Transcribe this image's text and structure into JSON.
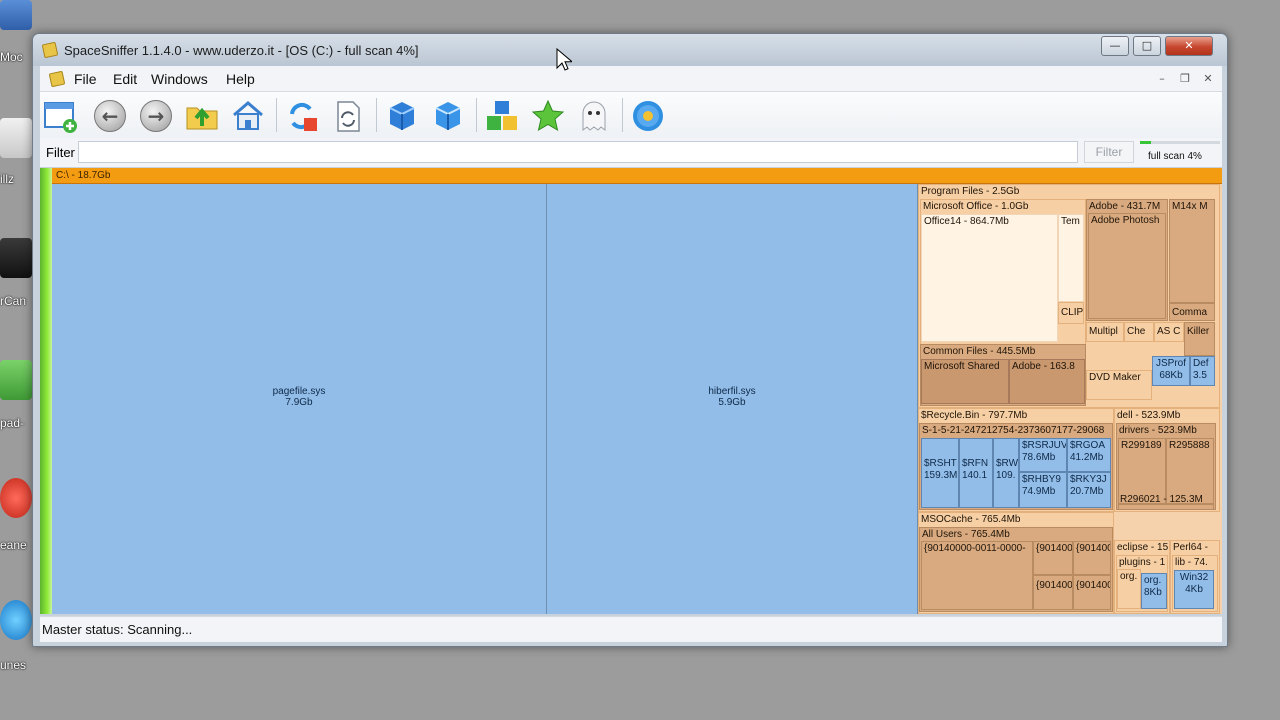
{
  "desktop": {
    "labels": [
      "Moc",
      "illz",
      "rCan",
      "pad-",
      "eane",
      "unes"
    ]
  },
  "window": {
    "title": "SpaceSniffer 1.1.4.0 - www.uderzo.it - [OS (C:) - full scan 4%]",
    "minimize": "—",
    "maximize": "□",
    "close": "✕"
  },
  "menu": {
    "file": "File",
    "edit": "Edit",
    "windows": "Windows",
    "help": "Help",
    "mdi_minimize": "–",
    "mdi_restore": "❐",
    "mdi_close": "✕"
  },
  "toolbar": {
    "icons": [
      "new-view-icon",
      "back-icon",
      "forward-icon",
      "up-folder-icon",
      "home-icon",
      "refresh-icon",
      "rescan-icon",
      "cube-icon",
      "cube-alt-icon",
      "blocks-icon",
      "star-icon",
      "ghost-icon",
      "settings-flower-icon"
    ]
  },
  "filter": {
    "label": "Filter",
    "value": "",
    "button": "Filter",
    "scan_progress": 0.04,
    "scan_text": "full scan 4%"
  },
  "treemap": {
    "root": "C:\\ - 18.7Gb",
    "pagefile_name": "pagefile.sys",
    "pagefile_size": "7.9Gb",
    "hiberfil_name": "hiberfil.sys",
    "hiberfil_size": "5.9Gb",
    "program_files": "Program Files - 2.5Gb",
    "microsoft_office": "Microsoft Office - 1.0Gb",
    "office14": "Office14 - 864.7Mb",
    "tem": "Tem",
    "clip": "CLIP",
    "adobe_pf": "Adobe - 431.7M",
    "adobe_photoshop": "Adobe Photosh",
    "m14x": "M14x M",
    "comma": "Comma",
    "multiple": "Multipl",
    "che": "Che",
    "as_c": "AS C",
    "killer": "Killer",
    "common_files": "Common Files - 445.5Mb",
    "microsoft_shared": "Microsoft Shared",
    "adobe_common": "Adobe - 163.8",
    "dvd_maker": "DVD Maker",
    "jsprof_name": "JSProf",
    "jsprof_size": "68Kb",
    "def_name": "Def",
    "def_size": "3.5",
    "recycle_bin": "$Recycle.Bin - 797.7Mb",
    "sid": "S-1-5-21-247212754-2373607177-29068",
    "rsht_name": "$RSHT",
    "rsht_size": "159.3M",
    "rfn_name": "$RFN",
    "rfn_size": "140.1",
    "rw_name": "$RW",
    "rw_size": "109.",
    "rsrjuv_name": "$RSRJUV",
    "rsrjuv_size": "78.6Mb",
    "rgoa_name": "$RGOA",
    "rgoa_size": "41.2Mb",
    "rhby_name": "$RHBY9",
    "rhby_size": "74.9Mb",
    "rky_name": "$RKY3J",
    "rky_size": "20.7Mb",
    "dell": "dell - 523.9Mb",
    "drivers": "drivers - 523.9Mb",
    "r299189": "R299189",
    "r295888": "R295888",
    "r296021": "R296021 - 125.3M",
    "msocache": "MSOCache - 765.4Mb",
    "all_users": "All Users - 765.4Mb",
    "office_guid": "{90140000-0011-0000-",
    "guid_a": "{901400",
    "guid_b": "{901400",
    "guid_c": "{901400",
    "guid_d": "{901400",
    "eclipse": "eclipse - 15",
    "plugins": "plugins - 1",
    "org_a": "org.",
    "org_b_name": "org.",
    "org_b_size": "8Kb",
    "perl64": "Perl64 -",
    "lib": "lib - 74.",
    "win32_name": "Win32",
    "win32_size": "4Kb"
  },
  "status": {
    "text": "Master status: Scanning..."
  }
}
